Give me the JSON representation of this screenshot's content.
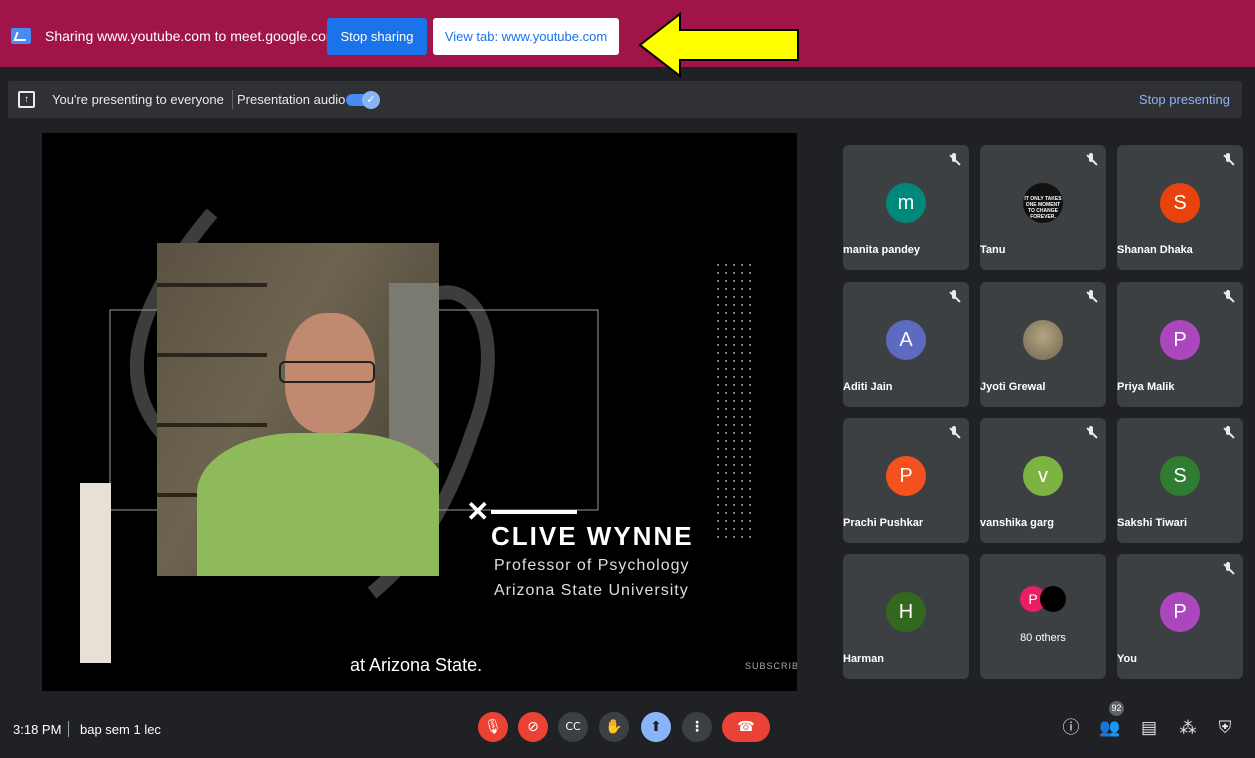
{
  "share_bar": {
    "text": "Sharing www.youtube.com to meet.google.com",
    "stop_label": "Stop sharing",
    "view_tab_label": "View tab: www.youtube.com",
    "background": "#a0144a"
  },
  "presenting_bar": {
    "text": "You're presenting to everyone",
    "audio_label": "Presentation audio",
    "audio_enabled": true,
    "stop_label": "Stop presenting"
  },
  "video": {
    "lower_third_name": "CLIVE WYNNE",
    "lower_third_role": "Professor of Psychology",
    "lower_third_org": "Arizona State University",
    "caption": "at Arizona State.",
    "subscribe": "SUBSCRIBE"
  },
  "participants": [
    {
      "name": "manita pandey",
      "initial": "m",
      "color": "#00897b",
      "muted": true
    },
    {
      "name": "Tanu",
      "initial": "",
      "color": "#111111",
      "muted": true,
      "avatar_text": "IT ONLY TAKES ONE MOMENT TO CHANGE FOREVER."
    },
    {
      "name": "Shanan Dhaka",
      "initial": "S",
      "color": "#e8430e",
      "muted": true
    },
    {
      "name": "Aditi Jain",
      "initial": "A",
      "color": "#5c6bc0",
      "muted": true
    },
    {
      "name": "Jyoti Grewal",
      "initial": "",
      "color": "#8a7f66",
      "muted": true
    },
    {
      "name": "Priya Malik",
      "initial": "P",
      "color": "#ab47bc",
      "muted": true
    },
    {
      "name": "Prachi Pushkar",
      "initial": "P",
      "color": "#f4511e",
      "muted": true
    },
    {
      "name": "vanshika garg",
      "initial": "v",
      "color": "#7cb342",
      "muted": true
    },
    {
      "name": "Sakshi Tiwari",
      "initial": "S",
      "color": "#2e7d32",
      "muted": true
    },
    {
      "name": "Harman",
      "initial": "H",
      "color": "#33691e",
      "muted": false
    },
    {
      "name": "80 others",
      "initial": "P",
      "color": "#e91e63",
      "muted": false
    },
    {
      "name": "You",
      "initial": "P",
      "color": "#ab47bc",
      "muted": true
    }
  ],
  "bottom_bar": {
    "time": "3:18 PM",
    "meeting_name": "bap sem 1 lec",
    "participant_count": "92"
  }
}
